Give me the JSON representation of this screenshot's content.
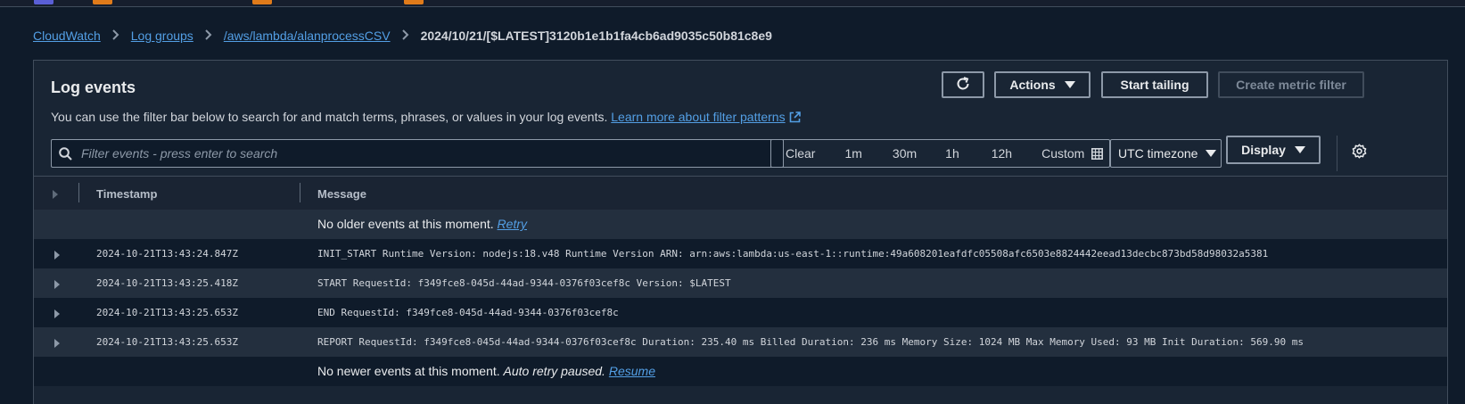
{
  "colors": {
    "background": "#0f1b2a",
    "panel": "#192534",
    "link": "#539fe5",
    "border": "#414d5c"
  },
  "breadcrumb": {
    "items": [
      "CloudWatch",
      "Log groups",
      "/aws/lambda/alanprocessCSV"
    ],
    "current": "2024/10/21/[$LATEST]3120b1e1b1fa4cb6ad9035c50b81c8e9"
  },
  "panel": {
    "title": "Log events",
    "description": "You can use the filter bar below to search for and match terms, phrases, or values in your log events.",
    "learn_more": "Learn more about filter patterns"
  },
  "toolbar": {
    "actions": "Actions",
    "start_tailing": "Start tailing",
    "create_metric_filter": "Create metric filter"
  },
  "search": {
    "placeholder": "Filter events - press enter to search",
    "value": ""
  },
  "range": {
    "clear": "Clear",
    "m1": "1m",
    "m30": "30m",
    "h1": "1h",
    "h12": "12h",
    "custom": "Custom"
  },
  "timezone": "UTC timezone",
  "display": "Display",
  "table": {
    "headers": {
      "timestamp": "Timestamp",
      "message": "Message"
    },
    "older": {
      "text": "No older events at this moment.",
      "link": "Retry"
    },
    "newer": {
      "text": "No newer events at this moment.",
      "paused": "Auto retry paused.",
      "link": "Resume"
    },
    "rows": [
      {
        "timestamp": "2024-10-21T13:43:24.847Z",
        "message": "INIT_START Runtime Version: nodejs:18.v48 Runtime Version ARN: arn:aws:lambda:us-east-1::runtime:49a608201eafdfc05508afc6503e8824442eead13decbc873bd58d98032a5381"
      },
      {
        "timestamp": "2024-10-21T13:43:25.418Z",
        "message": "START RequestId: f349fce8-045d-44ad-9344-0376f03cef8c Version: $LATEST"
      },
      {
        "timestamp": "2024-10-21T13:43:25.653Z",
        "message": "END RequestId: f349fce8-045d-44ad-9344-0376f03cef8c"
      },
      {
        "timestamp": "2024-10-21T13:43:25.653Z",
        "message": "REPORT RequestId: f349fce8-045d-44ad-9344-0376f03cef8c Duration: 235.40 ms Billed Duration: 236 ms Memory Size: 1024 MB Max Memory Used: 93 MB Init Duration: 569.90 ms"
      }
    ]
  }
}
